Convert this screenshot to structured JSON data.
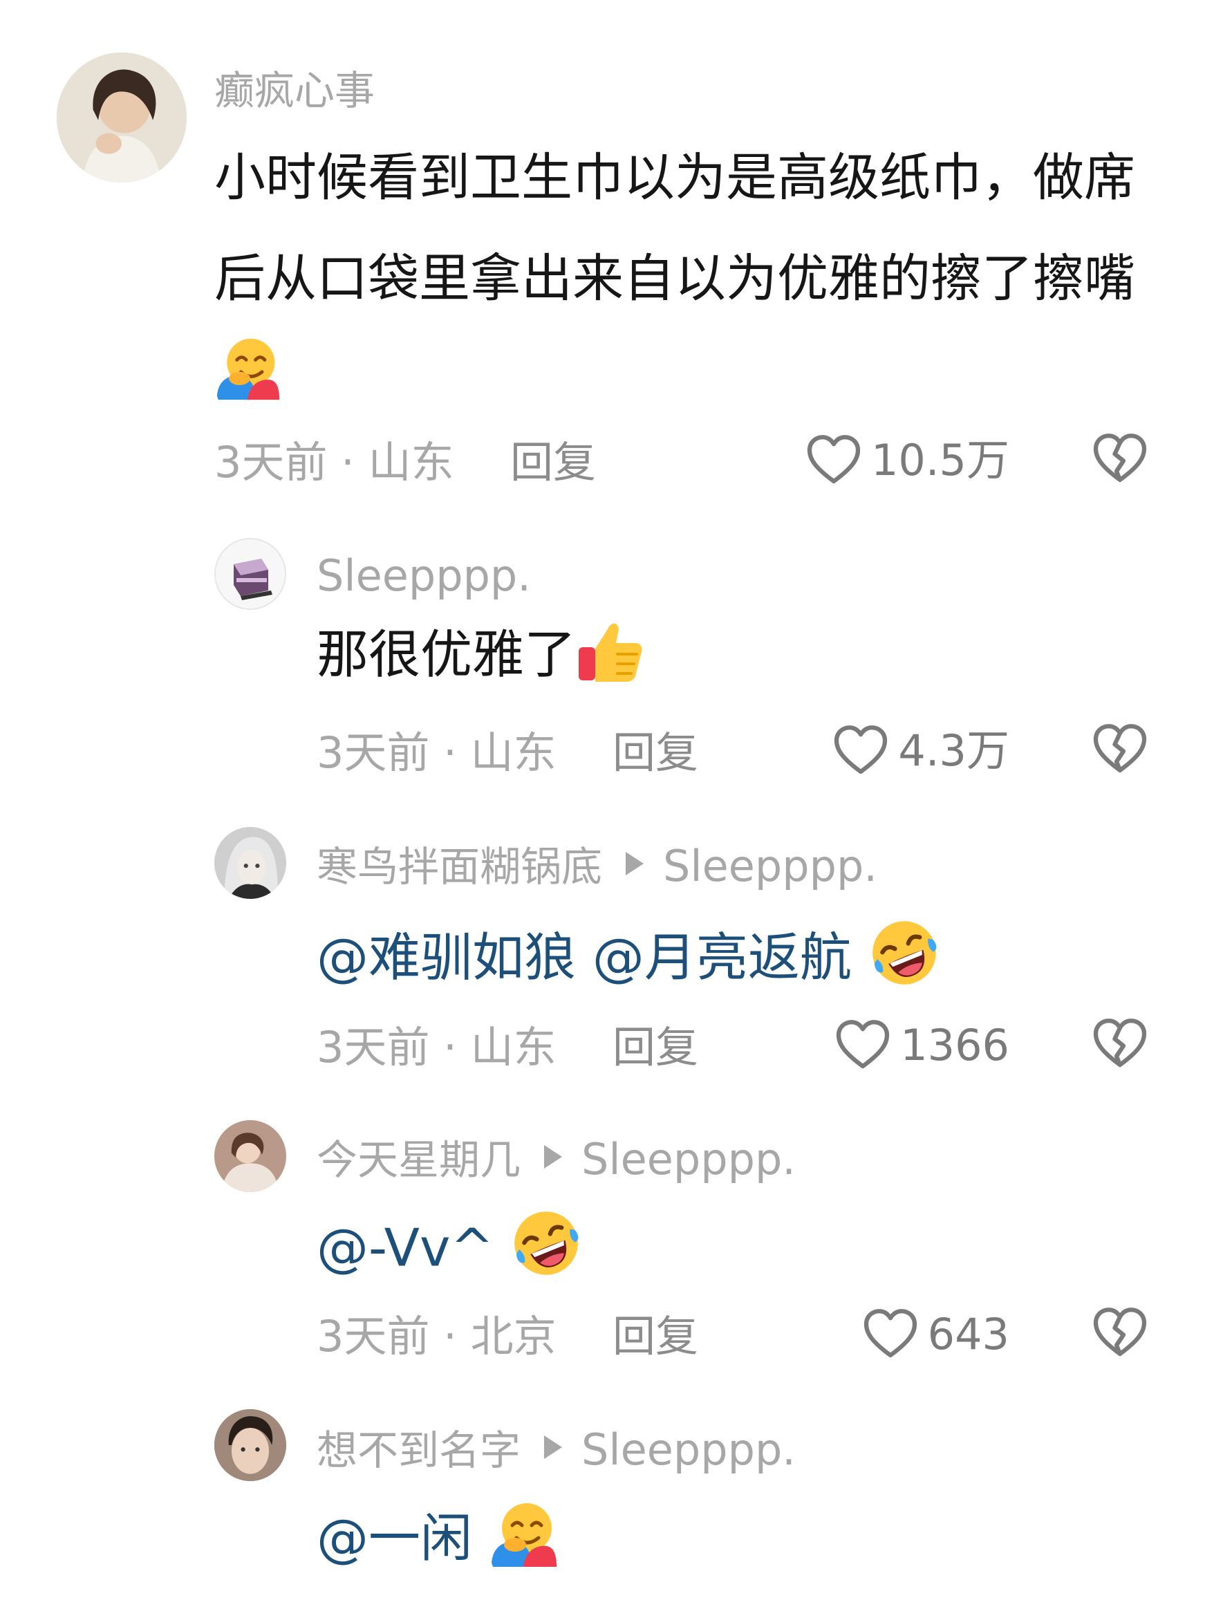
{
  "colors": {
    "username": "#a7a7a7",
    "content": "#161616",
    "mention": "#1d4f7b",
    "meta": "#a7a7a7",
    "icon": "#7a7a7a"
  },
  "comments": [
    {
      "username": "癫疯心事",
      "text_line1": "小时候看到卫生巾以为是高级纸巾，做席",
      "text_line2": "后从口袋里拿出来自以为优雅的擦了擦嘴",
      "emoji": "hugging-face-emoji",
      "time_location": "3天前 · 山东",
      "reply_label": "回复",
      "likes": "10.5万"
    }
  ],
  "replies": [
    {
      "username": "Sleepppp.",
      "text": "那很优雅了",
      "emoji": "thumbs-up-emoji",
      "time_location": "3天前 · 山东",
      "reply_label": "回复",
      "likes": "4.3万"
    },
    {
      "username": "寒鸟拌面糊锅底",
      "reply_to": "Sleepppp.",
      "mentions": [
        "@难驯如狼",
        "@月亮返航"
      ],
      "emoji": "rofl-crying-laughing-emoji",
      "time_location": "3天前 · 山东",
      "reply_label": "回复",
      "likes": "1366"
    },
    {
      "username": "今天星期几",
      "reply_to": "Sleepppp.",
      "mentions": [
        "@-Vv^"
      ],
      "emoji": "rofl-crying-laughing-emoji",
      "time_location": "3天前 · 北京",
      "reply_label": "回复",
      "likes": "643"
    },
    {
      "username": "想不到名字",
      "reply_to": "Sleepppp.",
      "mentions": [
        "@一闲"
      ],
      "emoji": "hugging-face-emoji"
    }
  ]
}
